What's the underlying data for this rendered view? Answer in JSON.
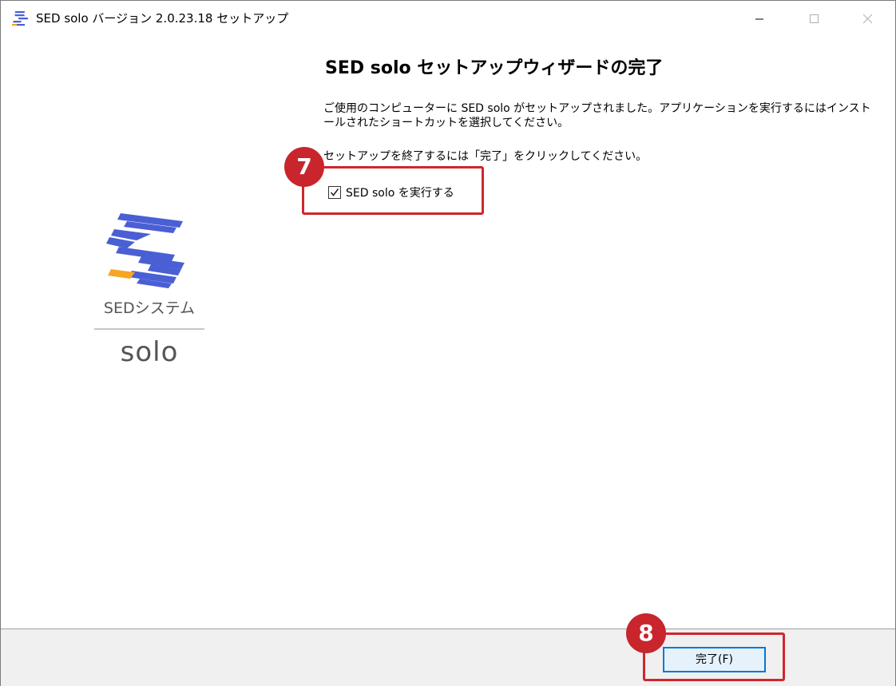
{
  "window": {
    "title": "SED solo バージョン 2.0.23.18 セットアップ",
    "icon": "sed-app-icon",
    "controls": [
      "minimize",
      "maximize",
      "close"
    ]
  },
  "sidebar": {
    "logo_icon": "sed-logo-mark",
    "company": "SEDシステム",
    "product": "solo"
  },
  "content": {
    "heading": "SED solo セットアップウィザードの完了",
    "description": "ご使用のコンピューターに SED solo がセットアップされました。アプリケーションを実行するにはインストールされたショートカットを選択してください。",
    "finish_note": "セットアップを終了するには「完了」をクリックしてください。",
    "run_checkbox": {
      "label": "SED solo を実行する",
      "checked": true
    }
  },
  "footer": {
    "finish_button": "完了(F)"
  },
  "annotations": {
    "step7": "7",
    "step8": "8",
    "color": "#c8252c"
  },
  "colors": {
    "logo_blue": "#4a5fd4",
    "logo_orange": "#f5a623",
    "button_border": "#0078d7",
    "button_bg": "#e5f1fb"
  }
}
